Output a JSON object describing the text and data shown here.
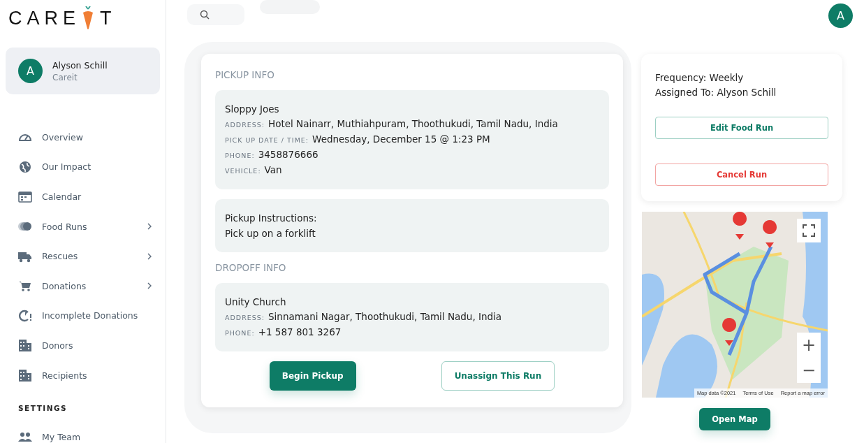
{
  "logo": {
    "text": "CARE",
    "text_end": "T"
  },
  "user": {
    "initial": "A",
    "name": "Alyson Schill",
    "org": "Careit"
  },
  "nav": [
    {
      "label": "Overview",
      "chevron": false
    },
    {
      "label": "Our Impact",
      "chevron": false
    },
    {
      "label": "Calendar",
      "chevron": false
    },
    {
      "label": "Food Runs",
      "chevron": true
    },
    {
      "label": "Rescues",
      "chevron": true
    },
    {
      "label": "Donations",
      "chevron": true
    },
    {
      "label": "Incomplete Donations",
      "chevron": false
    },
    {
      "label": "Donors",
      "chevron": false
    },
    {
      "label": "Recipients",
      "chevron": false
    }
  ],
  "settings": {
    "heading": "SETTINGS",
    "items": [
      {
        "label": "My Team"
      }
    ]
  },
  "top_avatar": {
    "initial": "A"
  },
  "pickup": {
    "heading": "PICKUP INFO",
    "name": "Sloppy Joes",
    "fields": [
      {
        "label": "ADDRESS:",
        "value": "Hotel Nainarr, Muthiahpuram, Thoothukudi, Tamil Nadu, India"
      },
      {
        "label": "PICK UP DATE / TIME:",
        "value": "Wednesday, December 15 @ 1:23 PM"
      },
      {
        "label": "PHONE:",
        "value": "3458876666"
      },
      {
        "label": "VEHICLE:",
        "value": "Van"
      }
    ],
    "instructions_title": "Pickup Instructions:",
    "instructions": "Pick up on a forklift"
  },
  "dropoff": {
    "heading": "DROPOFF INFO",
    "name": "Unity Church",
    "fields": [
      {
        "label": "ADDRESS:",
        "value": "Sinnamani Nagar, Thoothukudi, Tamil Nadu, India"
      },
      {
        "label": "PHONE:",
        "value": "+1 587 801 3267"
      }
    ]
  },
  "actions": [
    {
      "label": "Begin Pickup",
      "kind": "primary"
    },
    {
      "label": "Unassign This Run",
      "kind": "outline"
    }
  ],
  "summary": {
    "lines": [
      "Frequency: Weekly",
      "Assigned To: Alyson Schill"
    ],
    "buttons": [
      {
        "label": "Edit Food Run",
        "kind": "edit"
      },
      {
        "label": "Cancel Run",
        "kind": "danger"
      }
    ]
  },
  "map": {
    "kind": "picture",
    "footer": [
      "Map data ©2021",
      "Terms of Use",
      "Report a map error"
    ],
    "zoom_in": "+",
    "zoom_out": "−"
  },
  "open_map": {
    "label": "Open Map"
  }
}
